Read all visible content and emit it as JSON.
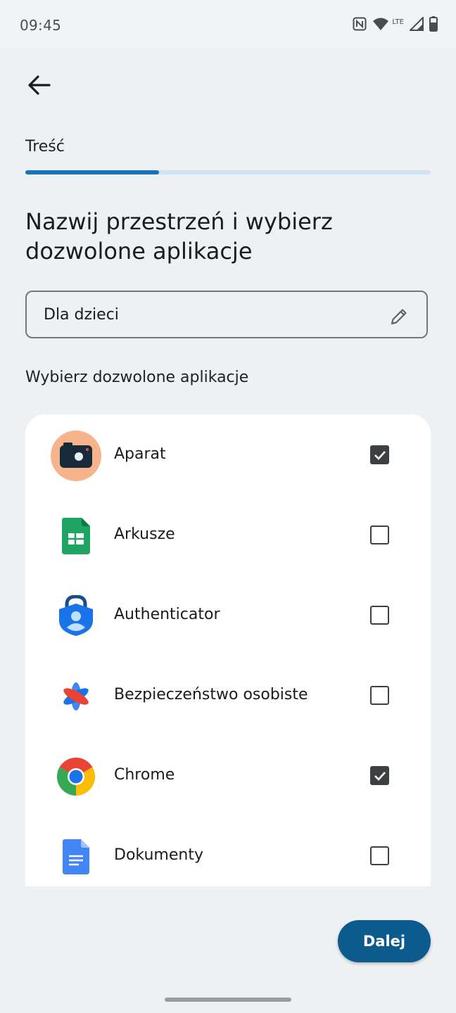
{
  "status_bar": {
    "time": "09:45",
    "network_label": "LTE",
    "icons": [
      "nfc-icon",
      "wifi-icon",
      "signal-icon",
      "battery-icon"
    ]
  },
  "header": {
    "back_icon": "arrow-back-icon",
    "section_label": "Treść",
    "progress_fraction": 0.33
  },
  "main": {
    "title": "Nazwij przestrzeń i wybierz dozwolone aplikacje",
    "name_field": {
      "value": "Dla dzieci",
      "edit_icon": "pencil-icon"
    },
    "apps_label": "Wybierz dozwolone aplikacje",
    "apps": [
      {
        "name": "Aparat",
        "icon": "camera-icon",
        "checked": true
      },
      {
        "name": "Arkusze",
        "icon": "sheets-icon",
        "checked": false
      },
      {
        "name": "Authenticator",
        "icon": "authenticator-icon",
        "checked": false
      },
      {
        "name": "Bezpieczeństwo osobiste",
        "icon": "personal-safety-icon",
        "checked": false
      },
      {
        "name": "Chrome",
        "icon": "chrome-icon",
        "checked": true
      },
      {
        "name": "Dokumenty",
        "icon": "docs-icon",
        "checked": false
      }
    ]
  },
  "footer": {
    "next_label": "Dalej"
  },
  "colors": {
    "accent": "#1674b3",
    "button": "#0c5b8c",
    "background": "#eef1f3"
  }
}
